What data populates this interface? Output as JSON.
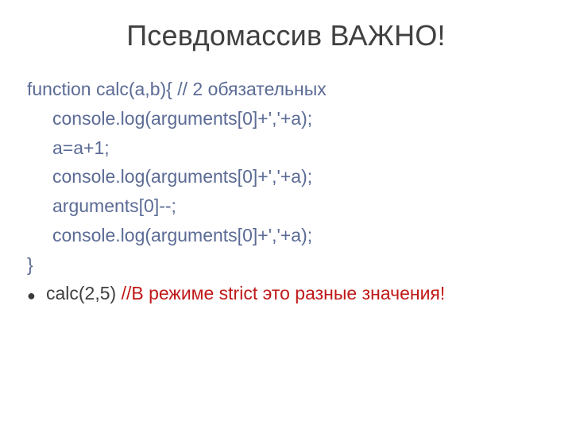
{
  "title": "Псевдомассив ВАЖНО!",
  "code": {
    "l0": "function calc(a,b){ // 2 обязательных",
    "l1": "console.log(arguments[0]+','+a);",
    "l2": "a=a+1;",
    "l3": "console.log(arguments[0]+','+a);",
    "l4": "arguments[0]--;",
    "l5": "console.log(arguments[0]+','+a);",
    "l6": "}"
  },
  "bullet": {
    "call": "calc(2,5) ",
    "comment": "//В режиме strict это разные значения!"
  }
}
